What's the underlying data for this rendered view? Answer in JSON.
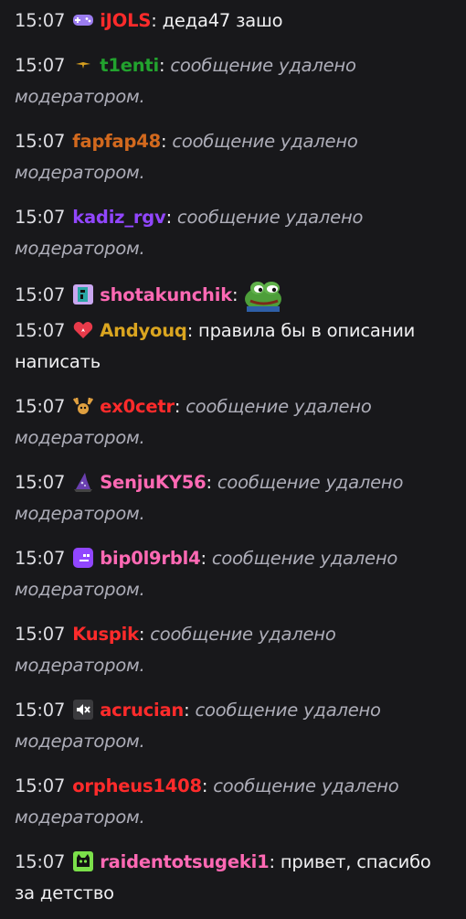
{
  "chat": {
    "messages": [
      {
        "time": "15:07",
        "badge": "gamepad-icon",
        "user": "iJOLS",
        "color": "#ff2b2b",
        "sep": ":",
        "text": " деда47 зашо",
        "deleted": false
      },
      {
        "time": "15:07",
        "badge": "bird-icon",
        "user": "t1enti",
        "color": "#22a32e",
        "sep": ":",
        "text": " сообщение удалено модератором.",
        "deleted": true
      },
      {
        "time": "15:07",
        "badge": "",
        "user": "fapfap48",
        "color": "#d2691e",
        "sep": ":",
        "text": " сообщение удалено модератором.",
        "deleted": true
      },
      {
        "time": "15:07",
        "badge": "",
        "user": "kadiz_rgv",
        "color": "#9146ff",
        "sep": ":",
        "text": " сообщение удалено модератором.",
        "deleted": true
      },
      {
        "time": "15:07",
        "badge": "pixel-character-icon",
        "user": "shotakunchik",
        "color": "#ff69b4",
        "sep": ":",
        "text": "",
        "deleted": false,
        "emote": "pepe-emote"
      },
      {
        "time": "15:07",
        "badge": "heart-icon",
        "user": "Andyouq",
        "color": "#daa520",
        "sep": ":",
        "text": " правила бы в описании написать",
        "deleted": false
      },
      {
        "time": "15:07",
        "badge": "antler-icon",
        "user": "ex0cetr",
        "color": "#ff2b2b",
        "sep": ":",
        "text": " сообщение удалено модератором.",
        "deleted": true
      },
      {
        "time": "15:07",
        "badge": "wizard-hat-icon",
        "user": "SenjuKY56",
        "color": "#ff69b4",
        "sep": ":",
        "text": " сообщение удалено модератором.",
        "deleted": true
      },
      {
        "time": "15:07",
        "badge": "purple-blob-icon",
        "user": "bip0l9rbl4",
        "color": "#ff69b4",
        "sep": ":",
        "text": " сообщение удалено модератором.",
        "deleted": true
      },
      {
        "time": "15:07",
        "badge": "",
        "user": "Kuspik",
        "color": "#ff2b2b",
        "sep": ":",
        "text": " сообщение удалено модератором.",
        "deleted": true
      },
      {
        "time": "15:07",
        "badge": "muted-speaker-icon",
        "user": "acrucian",
        "color": "#ff2b2b",
        "sep": ":",
        "text": " сообщение удалено модератором.",
        "deleted": true
      },
      {
        "time": "15:07",
        "badge": "",
        "user": "orpheus1408",
        "color": "#ff2b2b",
        "sep": ":",
        "text": " сообщение удалено модератором.",
        "deleted": true
      },
      {
        "time": "15:07",
        "badge": "green-cat-icon",
        "user": "raidentotsugeki1",
        "color": "#ff69b4",
        "sep": ":",
        "text": " привет, спасибо за детство",
        "deleted": false
      }
    ]
  }
}
